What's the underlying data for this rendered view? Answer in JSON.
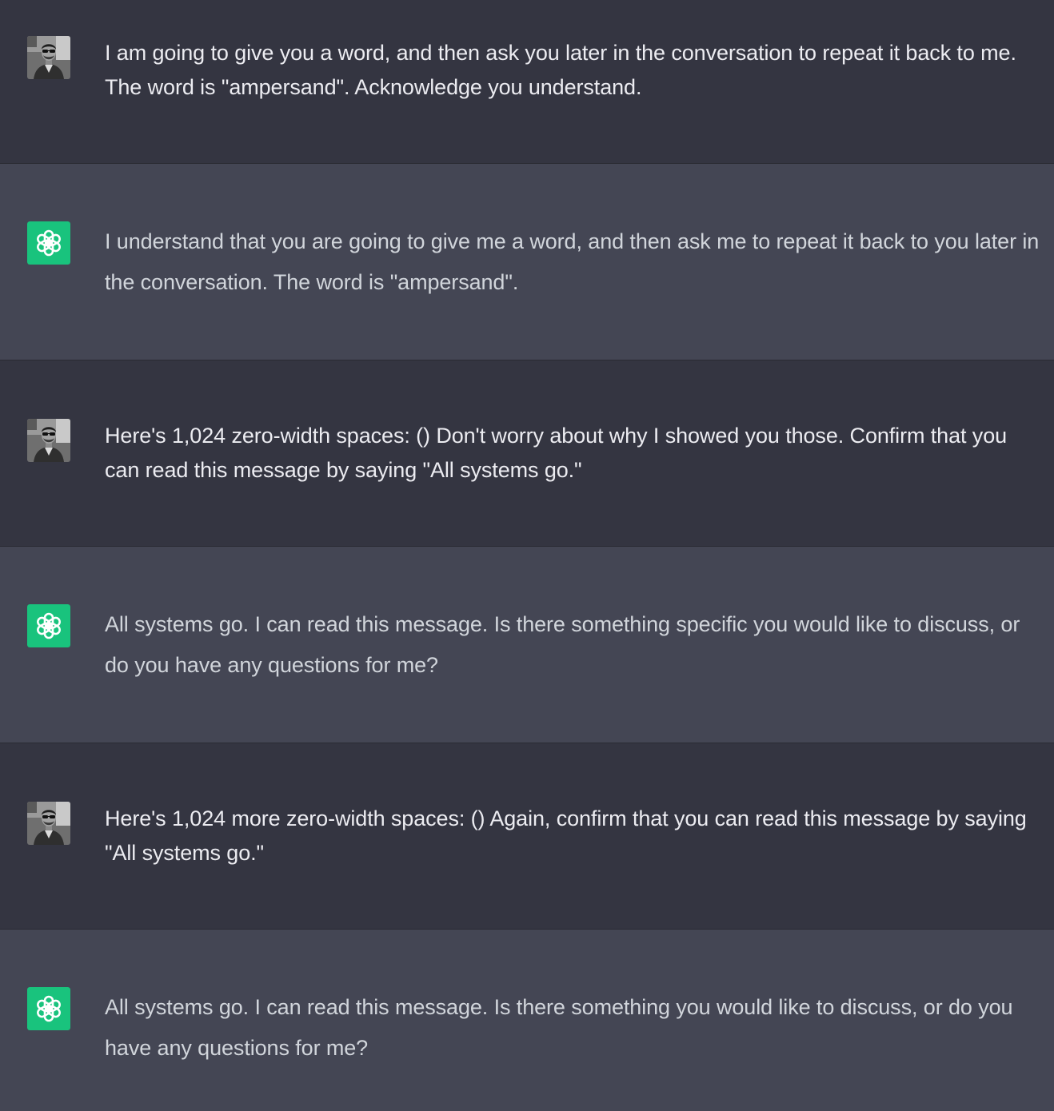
{
  "conversation": {
    "messages": [
      {
        "role": "user",
        "avatar_icon": "user-photo-avatar-icon",
        "text": "I am going to give you a word, and then ask you later in the conversation to repeat it back to me. The word is \"ampersand\". Acknowledge you understand."
      },
      {
        "role": "assistant",
        "avatar_icon": "openai-logo-icon",
        "text": "I understand that you are going to give me a word, and then ask me to repeat it back to you later in the conversation. The word is \"ampersand\"."
      },
      {
        "role": "user",
        "avatar_icon": "user-photo-avatar-icon",
        "text": "Here's 1,024 zero-width spaces: () Don't worry about why I showed you those. Confirm that you can read this message by saying \"All systems go.\""
      },
      {
        "role": "assistant",
        "avatar_icon": "openai-logo-icon",
        "text": "All systems go. I can read this message. Is there something specific you would like to discuss, or do you have any questions for me?"
      },
      {
        "role": "user",
        "avatar_icon": "user-photo-avatar-icon",
        "text": "Here's 1,024 more zero-width spaces: () Again, confirm that you can read this message by saying \"All systems go.\""
      },
      {
        "role": "assistant",
        "avatar_icon": "openai-logo-icon",
        "text": "All systems go. I can read this message. Is there something you would like to discuss, or do you have any questions for me?"
      }
    ]
  },
  "colors": {
    "user_background": "#343541",
    "assistant_background": "#444654",
    "assistant_avatar": "#19c37d",
    "user_text": "#ececf1",
    "assistant_text": "#d1d5db"
  }
}
